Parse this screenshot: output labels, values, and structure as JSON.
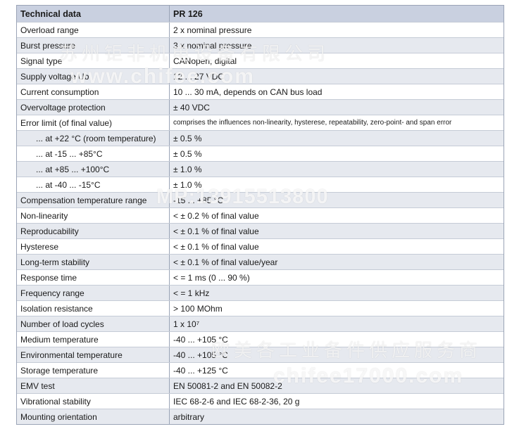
{
  "table": {
    "header": {
      "label": "Technical data",
      "value": "PR 126"
    },
    "rows": [
      {
        "label": "Overload range",
        "value": "2 x nominal pressure"
      },
      {
        "label": "Burst pressure",
        "value": "3 x nominal pressure"
      },
      {
        "label": "Signal type",
        "value": "CANopen, digital"
      },
      {
        "label": "Supply voltage Ub",
        "value": "12 ... 27 VDC"
      },
      {
        "label": "Current consumption",
        "value": "10 ... 30 mA, depends on CAN bus load"
      },
      {
        "label": "Overvoltage protection",
        "value": "± 40 VDC"
      },
      {
        "label": "Error limit (of final value)",
        "value": "comprises the influences non-linearity, hysterese, repeatability, zero-point- and span error"
      },
      {
        "label": "... at +22 °C (room temperature)",
        "value": "± 0.5 %"
      },
      {
        "label": "... at -15 ... +85°C",
        "value": "± 0.5 %"
      },
      {
        "label": "... at +85 ... +100°C",
        "value": "± 1.0 %"
      },
      {
        "label": "... at -40 ... -15°C",
        "value": "± 1.0 %"
      },
      {
        "label": "Compensation temperature range",
        "value": "-15 ... +85 °C"
      },
      {
        "label": "Non-linearity",
        "value": "< ± 0.2 % of final value"
      },
      {
        "label": "Reproducability",
        "value": "< ± 0.1 % of final value"
      },
      {
        "label": "Hysterese",
        "value": "< ± 0.1 % of final value"
      },
      {
        "label": "Long-term stability",
        "value": "< ± 0.1 % of final value/year"
      },
      {
        "label": "Response time",
        "value": "< = 1 ms (0 ... 90 %)"
      },
      {
        "label": "Frequency range",
        "value": "< = 1 kHz"
      },
      {
        "label": "Isolation resistance",
        "value": "> 100 MOhm"
      },
      {
        "label": "Number of load cycles",
        "value": "1 x 10⁷"
      },
      {
        "label": "Medium temperature",
        "value": "-40 ... +105 °C"
      },
      {
        "label": "Environmental temperature",
        "value": "-40 ... +105 °C"
      },
      {
        "label": "Storage temperature",
        "value": "-40 ... +125 °C"
      },
      {
        "label": "EMV test",
        "value": "EN 50081-2 and EN 50082-2"
      },
      {
        "label": "Vibrational stability",
        "value": "IEC 68-2-6 and IEC 68-2-36, 20 g"
      },
      {
        "label": "Mounting orientation",
        "value": "arbitrary"
      }
    ]
  },
  "watermarks": {
    "company_top": "苏州钜非机电设备有限公司",
    "site_top": "www.chifee.com",
    "phone": "MP:13915513800",
    "company_bottom": "欧美各工业备件供应服务商",
    "site_bottom": "chifee17000.com"
  }
}
